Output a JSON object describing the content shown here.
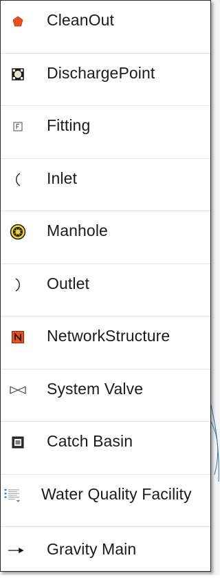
{
  "items": [
    {
      "label": "CleanOut",
      "icon": "cleanout-icon"
    },
    {
      "label": "DischargePoint",
      "icon": "discharge-point-icon"
    },
    {
      "label": "Fitting",
      "icon": "fitting-icon"
    },
    {
      "label": "Inlet",
      "icon": "inlet-icon"
    },
    {
      "label": "Manhole",
      "icon": "manhole-icon"
    },
    {
      "label": "Outlet",
      "icon": "outlet-icon"
    },
    {
      "label": "NetworkStructure",
      "icon": "network-structure-icon"
    },
    {
      "label": "System Valve",
      "icon": "system-valve-icon"
    },
    {
      "label": "Catch Basin",
      "icon": "catch-basin-icon"
    },
    {
      "label": "Water Quality Facility",
      "icon": "water-quality-facility-icon"
    },
    {
      "label": "Gravity Main",
      "icon": "gravity-main-icon"
    }
  ],
  "colors": {
    "cleanout": "#e8501e",
    "manhole": "#f2d21a",
    "network_structure": "#e8501e",
    "water_quality": "#2d7dd2"
  }
}
